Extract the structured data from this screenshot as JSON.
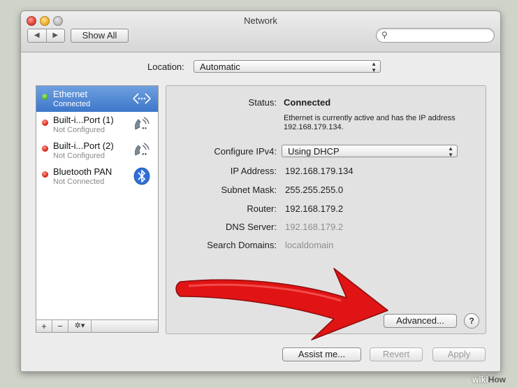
{
  "window": {
    "title": "Network",
    "nav_back": "◀",
    "nav_forward": "▶",
    "show_all": "Show All",
    "search_placeholder": ""
  },
  "location": {
    "label": "Location:",
    "value": "Automatic"
  },
  "services": [
    {
      "name": "Ethernet",
      "status": "Connected",
      "indicator": "green",
      "icon": "ethernet-icon",
      "selected": true
    },
    {
      "name": "Built-i...Port (1)",
      "status": "Not Configured",
      "indicator": "red",
      "icon": "modem-icon",
      "selected": false
    },
    {
      "name": "Built-i...Port (2)",
      "status": "Not Configured",
      "indicator": "red",
      "icon": "modem-icon",
      "selected": false
    },
    {
      "name": "Bluetooth PAN",
      "status": "Not Connected",
      "indicator": "red",
      "icon": "bluetooth-icon",
      "selected": false
    }
  ],
  "sidebar_tools": {
    "add": "+",
    "remove": "−",
    "gear": "✲▾"
  },
  "detail": {
    "status_label": "Status:",
    "status_value": "Connected",
    "status_desc": "Ethernet is currently active and has the IP address 192.168.179.134.",
    "configure_label": "Configure IPv4:",
    "configure_value": "Using DHCP",
    "ip_label": "IP Address:",
    "ip_value": "192.168.179.134",
    "subnet_label": "Subnet Mask:",
    "subnet_value": "255.255.255.0",
    "router_label": "Router:",
    "router_value": "192.168.179.2",
    "dns_label": "DNS Server:",
    "dns_value": "192.168.179.2",
    "search_domains_label": "Search Domains:",
    "search_domains_value": "localdomain"
  },
  "buttons": {
    "advanced": "Advanced...",
    "help": "?",
    "assist": "Assist me...",
    "revert": "Revert",
    "apply": "Apply"
  },
  "watermark": {
    "part1": "wiki",
    "part2": "How"
  },
  "colors": {
    "selection": "#3d77c9",
    "arrow": "#e01414",
    "connected": "#4db22a",
    "disconnected": "#d8281c"
  }
}
